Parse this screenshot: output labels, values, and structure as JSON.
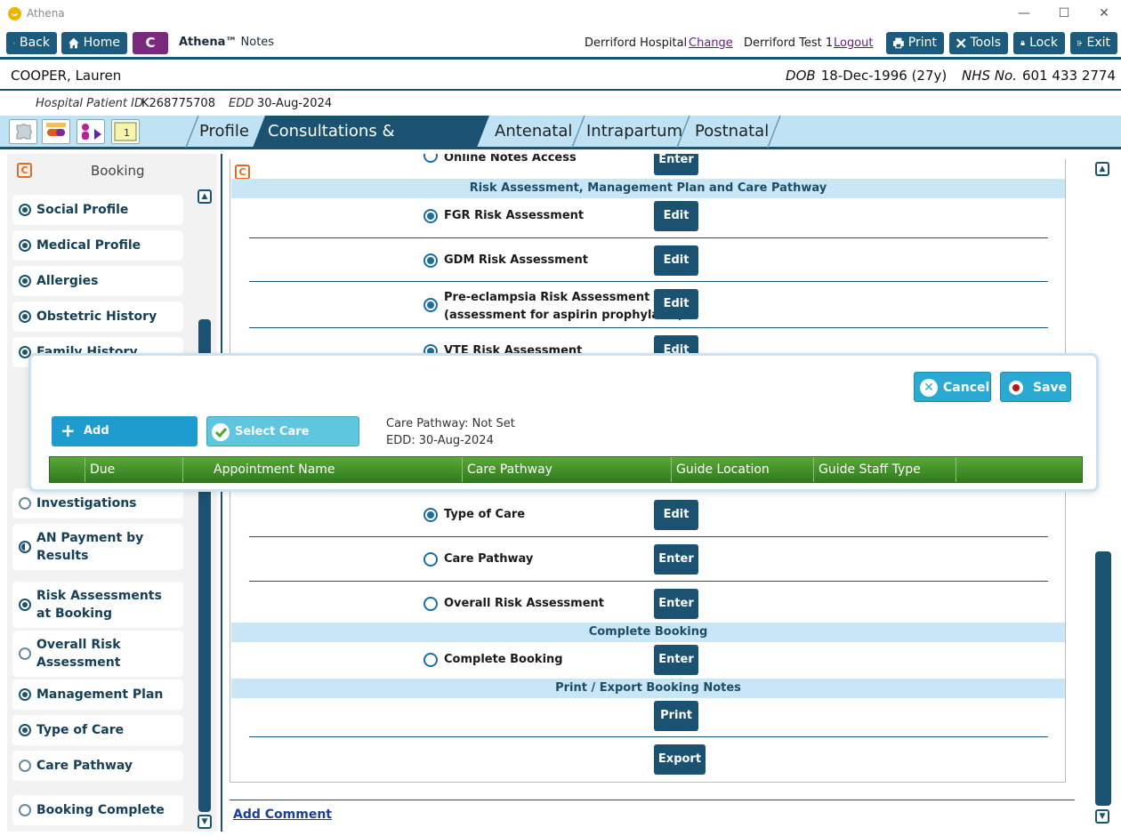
{
  "window": {
    "title": "Athena"
  },
  "toolbar": {
    "back": "Back",
    "home": "Home",
    "logo_letter": "C",
    "brand_name": "Athena™",
    "brand_suffix": "Notes",
    "hospital": "Derriford Hospital",
    "change": "Change",
    "user": "Derriford Test 1",
    "logout": "Logout",
    "print": "Print",
    "tools": "Tools",
    "lock": "Lock",
    "exit": "Exit"
  },
  "patient": {
    "name": "COOPER, Lauren",
    "dob_label": "DOB",
    "dob": "18-Dec-1996 (27y)",
    "nhs_label": "NHS No.",
    "nhs": "601 433 2774",
    "hosp_id_label": "Hospital Patient ID",
    "hosp_id": "K268775708",
    "edd_label": "EDD",
    "edd": "30-Aug-2024"
  },
  "tabs": [
    "Profile",
    "Consultations & Admissions",
    "Antenatal",
    "Intrapartum",
    "Postnatal"
  ],
  "active_tab": "Consultations & Admissions",
  "sidebar": {
    "title": "Booking",
    "items": [
      {
        "label": "Social Profile",
        "state": "on"
      },
      {
        "label": "Medical Profile",
        "state": "on"
      },
      {
        "label": "Allergies",
        "state": "on"
      },
      {
        "label": "Obstetric History",
        "state": "on"
      },
      {
        "label": "Family History",
        "state": "on"
      },
      {
        "label": "Investigations",
        "state": "empty"
      },
      {
        "label": "AN Payment by Results",
        "state": "half"
      },
      {
        "label": "Risk Assessments at Booking",
        "state": "on"
      },
      {
        "label": "Overall Risk Assessment",
        "state": "empty"
      },
      {
        "label": "Management Plan",
        "state": "on"
      },
      {
        "label": "Type of Care",
        "state": "on"
      },
      {
        "label": "Care Pathway",
        "state": "empty"
      },
      {
        "label": "Booking Complete",
        "state": "empty"
      }
    ]
  },
  "main": {
    "top_partial": {
      "label": "Online Notes Access",
      "button": "Enter"
    },
    "section1": "Risk Assessment, Management Plan and Care Pathway",
    "rows1": [
      {
        "label": "FGR Risk Assessment",
        "button": "Edit"
      },
      {
        "label": "GDM Risk Assessment",
        "button": "Edit"
      },
      {
        "label": "Pre-eclampsia Risk Assessment",
        "label2": "(assessment for aspirin prophylaxis)",
        "button": "Edit"
      },
      {
        "label": "VTE Risk Assessment",
        "button": "Edit"
      }
    ],
    "rows2": [
      {
        "label": "Type of Care",
        "button": "Edit",
        "checked": true
      },
      {
        "label": "Care Pathway",
        "button": "Enter",
        "checked": false
      },
      {
        "label": "Overall Risk Assessment",
        "button": "Enter",
        "checked": false
      }
    ],
    "section2": "Complete Booking",
    "complete_row": {
      "label": "Complete Booking",
      "button": "Enter"
    },
    "section3": "Print / Export Booking Notes",
    "print_button": "Print",
    "export_button": "Export",
    "add_comment": "Add Comment"
  },
  "modal": {
    "cancel": "Cancel",
    "save": "Save",
    "add_appointment": "Add Appointment",
    "select_pathway": "Select Care Pathway",
    "care_pathway_text": "Care Pathway: Not Set",
    "edd_text": "EDD: 30-Aug-2024",
    "columns": [
      "Due",
      "Appointment Name",
      "Care Pathway",
      "Guide Location",
      "Guide Staff Type"
    ]
  },
  "colors": {
    "navy": "#1b5271",
    "header_blue": "#c8e6f6",
    "grid_green": "#3f8f28",
    "modal_button": "#2aa9d2"
  }
}
